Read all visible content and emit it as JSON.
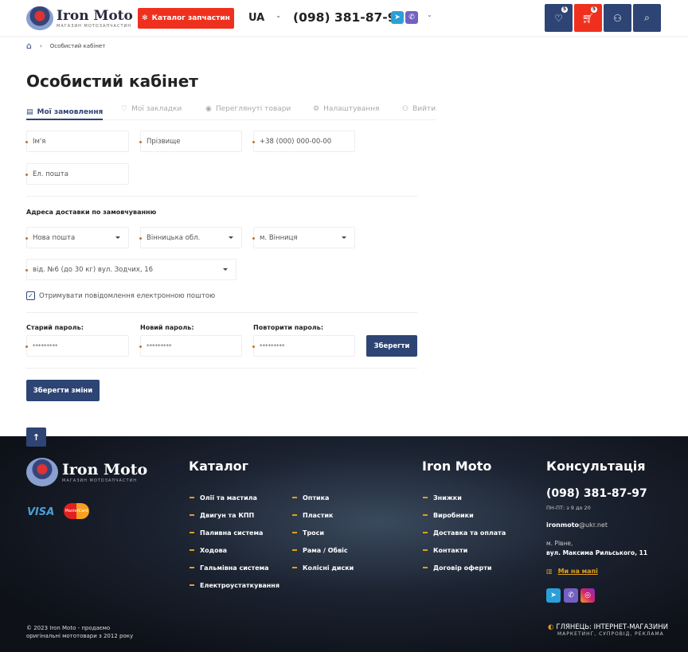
{
  "header": {
    "logo_name": "Iron Moto",
    "logo_sub": "МАГАЗИН МОТОЗАПЧАСТИН",
    "catalog_button": "Каталог запчастин",
    "lang": "UA",
    "phone": "(098) 381-87-97",
    "wishlist_count": "5",
    "cart_count": "5"
  },
  "breadcrumb": {
    "current": "Особистий кабінет"
  },
  "page": {
    "title": "Особистий кабінет"
  },
  "tabs": [
    {
      "label": "Мої замовлення",
      "icon": "orders-icon",
      "active": true
    },
    {
      "label": "Мої закладки",
      "icon": "heart-icon"
    },
    {
      "label": "Переглянуті товари",
      "icon": "eye-icon"
    },
    {
      "label": "Налаштування",
      "icon": "gear-icon"
    },
    {
      "label": "Вийти",
      "icon": "logout-icon"
    }
  ],
  "form": {
    "first_name_placeholder": "Ім'я",
    "last_name_placeholder": "Прізвище",
    "phone_placeholder": "+38 (000) 000-00-00",
    "email_placeholder": "Ел. пошта",
    "address_title": "Адреса доставки по замовчуванню",
    "carrier": "Нова пошта",
    "region": "Вінницька обл.",
    "city": "м. Вінниця",
    "branch": "від. №6 (до 30 кг) вул. Зодчих, 16",
    "newsletter_label": "Отримувати повідомлення електронною поштою",
    "newsletter_checked": true,
    "old_password_label": "Старий пароль:",
    "new_password_label": "Новий пароль:",
    "repeat_password_label": "Повторити пароль:",
    "password_mask": "*********",
    "save_password": "Зберегти",
    "save_changes": "Зберегти зміни"
  },
  "footer": {
    "logo_name": "Iron Moto",
    "logo_sub": "МАГАЗИН МОТОЗАПЧАСТИН",
    "visa": "VISA",
    "mastercard": "MasterCard",
    "catalog_title": "Каталог",
    "catalog_col1": [
      "Олії та мастила",
      "Двигун та КПП",
      "Паливна система",
      "Ходова",
      "Гальмівна система",
      "Електроустаткування"
    ],
    "catalog_col2": [
      "Оптика",
      "Пластик",
      "Троси",
      "Рама / Обвіс",
      "Колісні диски"
    ],
    "company_title": "Iron Moto",
    "company_links": [
      "Знижки",
      "Виробники",
      "Доставка та оплата",
      "Контакти",
      "Договір оферти"
    ],
    "consult_title": "Консультація",
    "phone": "(098) 381-87-97",
    "hours": "ПН-ПТ: з 9 до 20",
    "email_user": "ironmoto",
    "email_domain": "@ukr.net",
    "city": "м. Рівне,",
    "street": "вул. Максима Рильського, 11",
    "map_link": "Ми на мапі",
    "copyright_1": "© 2023 Iron Moto - продаємо",
    "copyright_2": "оригінальні мототовари з 2012 року",
    "dev_name": "ГЛЯНЕЦЬ: ІНТЕРНЕТ-МАГАЗИНИ",
    "dev_sub": "МАРКЕТИНГ, СУПРОВІД, РЕКЛАМА"
  },
  "colors": {
    "navy": "#2d4474",
    "red": "#f0301e",
    "accent": "#e0a020"
  }
}
